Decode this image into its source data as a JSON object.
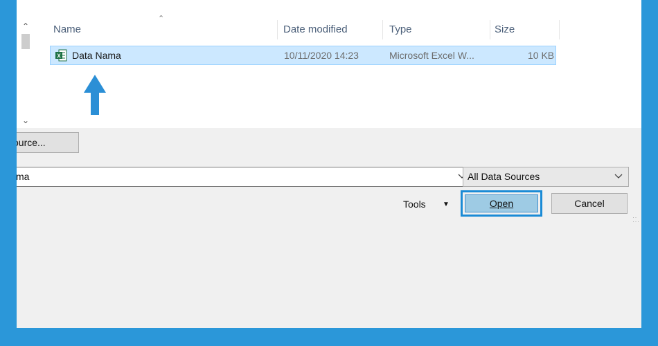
{
  "columns": {
    "name": "Name",
    "date_modified": "Date modified",
    "type": "Type",
    "size": "Size"
  },
  "files": [
    {
      "name": "Data Nama",
      "date_modified": "10/11/2020 14:23",
      "type": "Microsoft Excel W...",
      "size": "10 KB",
      "icon": "excel-file-icon"
    }
  ],
  "source_button_label": "ource...",
  "filename_value": "ma",
  "filter_value": "All Data Sources",
  "tools_label": "Tools",
  "open_label": "Open",
  "cancel_label": "Cancel",
  "colors": {
    "frame": "#2b97d9",
    "selection": "#cce8ff",
    "annotation_arrow": "#2b8fd6",
    "excel_green": "#1e7145"
  }
}
